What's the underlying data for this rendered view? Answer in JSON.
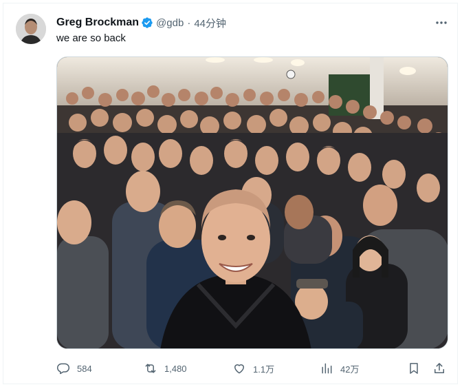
{
  "author": {
    "name": "Greg Brockman",
    "handle": "@gdb",
    "separator": "·",
    "time": "44分钟"
  },
  "tweet": {
    "text": "we are so back"
  },
  "actions": {
    "replies": "584",
    "reposts": "1,480",
    "likes": "1.1万",
    "views": "42万"
  },
  "icons": {
    "verified": "verified-badge-icon",
    "more": "more-icon",
    "reply": "reply-icon",
    "repost": "repost-icon",
    "like": "like-icon",
    "views": "views-icon",
    "bookmark": "bookmark-icon",
    "share": "share-icon"
  },
  "colors": {
    "verified": "#1d9bf0",
    "text": "#0f1419",
    "secondary": "#536471"
  }
}
